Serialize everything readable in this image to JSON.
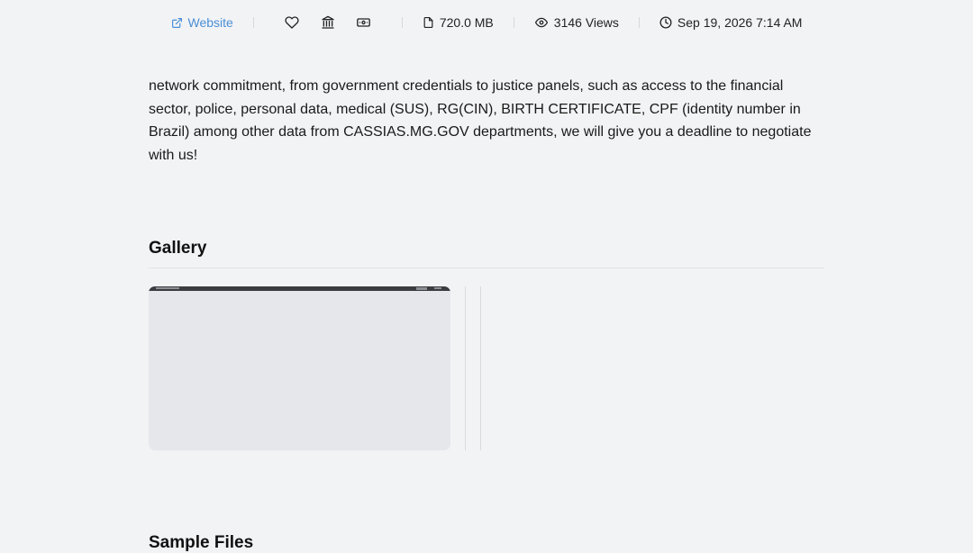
{
  "meta": {
    "website_label": "Website",
    "size": "720.0 MB",
    "views": "3146 Views",
    "date": "Sep 19, 2026 7:14 AM"
  },
  "description": "network commitment, from government credentials to justice panels, such as access to the financial sector, police, personal data, medical (SUS), RG(CIN), BIRTH CERTIFICATE, CPF (identity number in Brazil) among other data from CASSIAS.MG.GOV departments, we will give you a deadline to negotiate with us!",
  "gallery": {
    "title": "Gallery"
  },
  "next_section": {
    "title": "Sample Files"
  },
  "icons": [
    "external-link-icon",
    "heart-icon",
    "bank-icon",
    "money-icon",
    "file-icon",
    "eye-icon",
    "clock-icon"
  ],
  "colors": {
    "accent": "#4a8fd6",
    "background": "#f2f3f5"
  }
}
